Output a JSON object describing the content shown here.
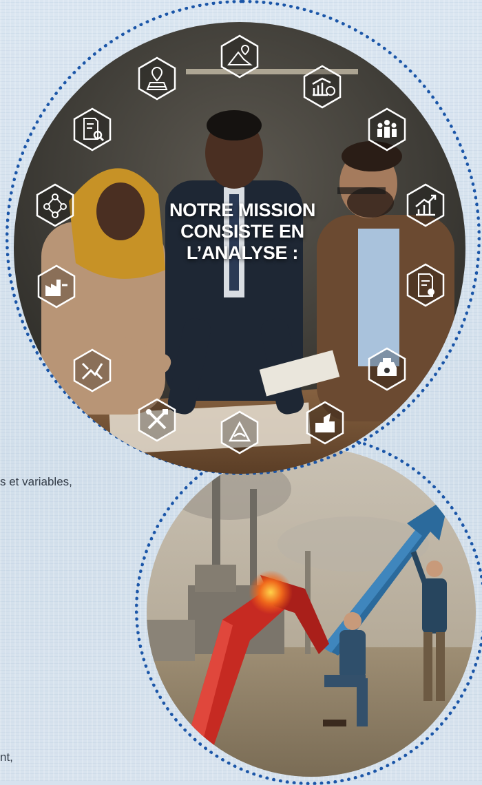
{
  "side_text": {
    "line1": "s et variables,",
    "line2": "nt,"
  },
  "mission": {
    "line1": "NOTRE MISSION",
    "line2": "CONSISTE EN",
    "line3": "L’ANALYSE :"
  },
  "icons": [
    "location-plan-icon",
    "map-route-icon",
    "chart-finance-icon",
    "team-people-icon",
    "growth-chart-icon",
    "document-gear-icon",
    "industrial-machine-icon",
    "land-terrain-icon",
    "water-treatment-icon",
    "tools-icon",
    "trend-cross-icon",
    "factory-energy-icon",
    "network-flow-icon",
    "document-search-icon"
  ],
  "colors": {
    "dots": "#1b56a8",
    "background": "#d6e2ee",
    "title": "#ffffff",
    "arrow_red": "#c62a22",
    "arrow_blue": "#2b6a9c"
  }
}
